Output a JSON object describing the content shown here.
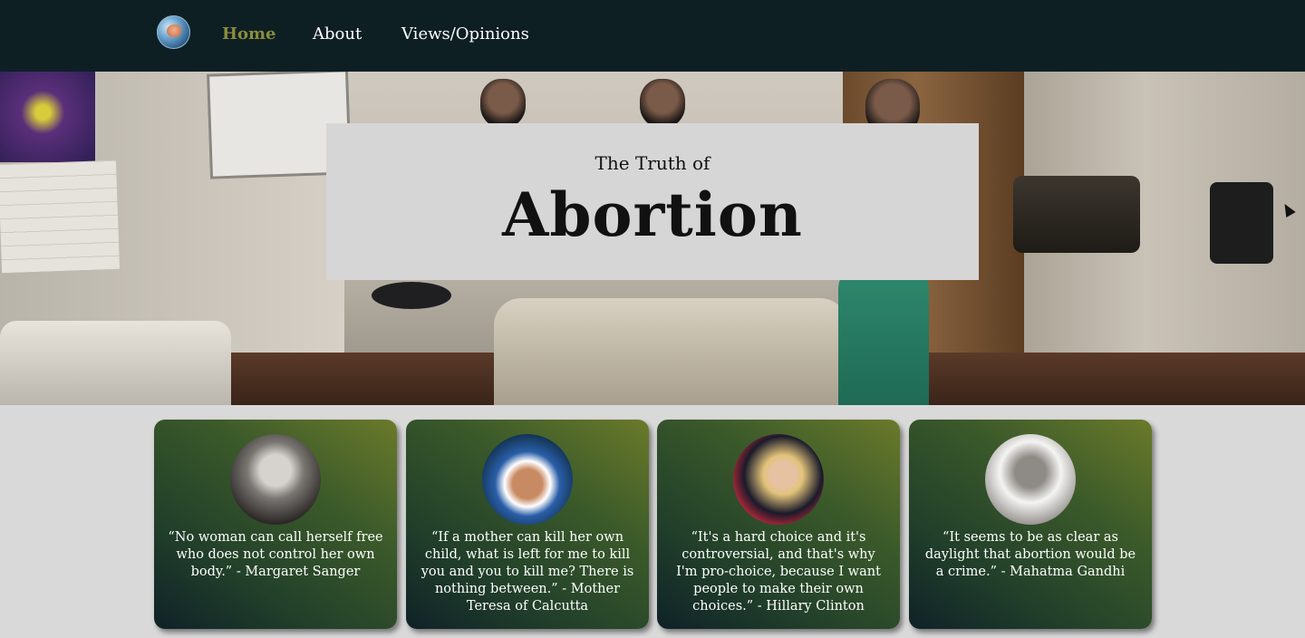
{
  "nav": {
    "items": [
      {
        "label": "Home",
        "active": true
      },
      {
        "label": "About"
      },
      {
        "label": "Views/Opinions"
      }
    ]
  },
  "hero": {
    "subtitle": "The Truth of",
    "title": "Abortion"
  },
  "cards": [
    {
      "quote": "“No woman can call herself free who does not control her own body.” - Margaret Sanger"
    },
    {
      "quote": "“If a mother can kill her own child, what is left for me to kill you and you to kill me? There is nothing between.” - Mother Teresa of Calcutta"
    },
    {
      "quote": "“It's a hard choice and it's controversial, and that's why I'm pro-choice, because I want people to make their own choices.” - Hillary Clinton"
    },
    {
      "quote": "“It seems to be as clear as daylight that abortion would be a crime.” - Mahatma Gandhi"
    }
  ],
  "colors": {
    "nav_bg": "#0e1f24",
    "nav_active": "#8a8d3b",
    "page_bg": "#d9d9d9",
    "card_gradient_start": "#6b7a2a",
    "card_gradient_end": "#0f2228",
    "title_box_bg": "#d6d6d6"
  }
}
